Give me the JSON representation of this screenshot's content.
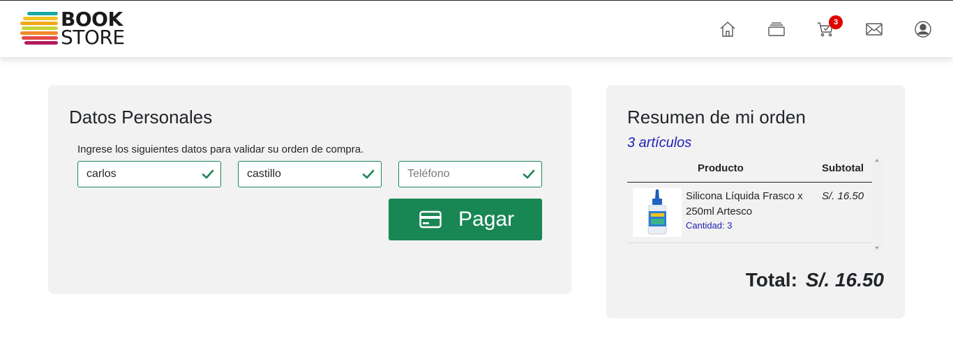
{
  "header": {
    "logo_line1": "BOOK",
    "logo_line2": "STORE",
    "cart_count": "3",
    "icons": [
      "home-icon",
      "books-icon",
      "cart-icon",
      "mail-icon",
      "user-icon"
    ]
  },
  "personal": {
    "title": "Datos Personales",
    "subtitle": "Ingrese los siguientes datos para validar su orden de compra.",
    "first_name": {
      "value": "carlos",
      "placeholder": ""
    },
    "last_name": {
      "value": "castillo",
      "placeholder": ""
    },
    "phone": {
      "value": "",
      "placeholder": "Teléfono"
    },
    "pay_label": "Pagar"
  },
  "summary": {
    "title": "Resumen de mi orden",
    "items_count": "3 artículos",
    "col_product": "Producto",
    "col_subtotal": "Subtotal",
    "items": [
      {
        "name": "Silicona Líquida Frasco x 250ml Artesco",
        "qty": "Cantidad: 3",
        "subtotal": "S/. 16.50"
      }
    ],
    "total_label": "Total:",
    "total_value": "S/. 16.50"
  },
  "colors": {
    "accent": "#198754",
    "link": "#1f1fb4",
    "badge": "#e00000",
    "card_bg": "#f2f2f2"
  }
}
